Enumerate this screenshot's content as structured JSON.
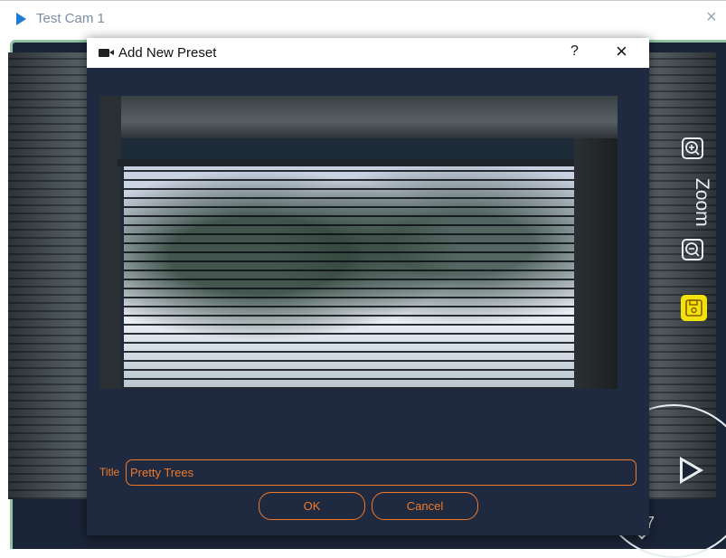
{
  "window": {
    "title": "Test Cam 1",
    "close_glyph": "×"
  },
  "camera_controls": {
    "zoom_label": "Zoom",
    "zoom_in_icon": "zoom-in-icon",
    "zoom_out_icon": "zoom-out-icon",
    "save_icon": "save-icon",
    "ptz_glyph": "7"
  },
  "dialog": {
    "title": "Add New Preset",
    "help_glyph": "?",
    "close_glyph": "×",
    "title_field_label": "Title",
    "title_field_value": "Pretty Trees",
    "ok_label": "OK",
    "cancel_label": "Cancel"
  },
  "colors": {
    "accent": "#f07a2a",
    "panel_bg": "#1f2940",
    "save_highlight": "#f2e20c",
    "play_icon": "#1f7ad6"
  }
}
